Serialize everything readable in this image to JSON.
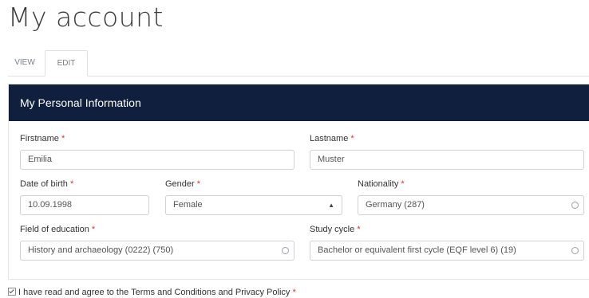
{
  "page": {
    "title": "My account"
  },
  "tabs": [
    {
      "label": "VIEW"
    },
    {
      "label": "EDIT"
    }
  ],
  "section": {
    "title": "My Personal Information"
  },
  "form": {
    "required_mark": "*",
    "firstname": {
      "label": "Firstname",
      "value": "Emilia"
    },
    "lastname": {
      "label": "Lastname",
      "value": "Muster"
    },
    "date_of_birth": {
      "label": "Date of birth",
      "value": "10.09.1998"
    },
    "gender": {
      "label": "Gender",
      "value": "Female"
    },
    "nationality": {
      "label": "Nationality",
      "value": "Germany (287)"
    },
    "field_of_education": {
      "label": "Field of education",
      "value": "History and archaeology (0222) (750)"
    },
    "study_cycle": {
      "label": "Study cycle",
      "value": "Bachelor or equivalent first cycle (EQF level 6) (19)"
    }
  },
  "terms": {
    "label": "I have read and agree to the Terms and Conditions and Privacy Policy",
    "checked": true
  }
}
